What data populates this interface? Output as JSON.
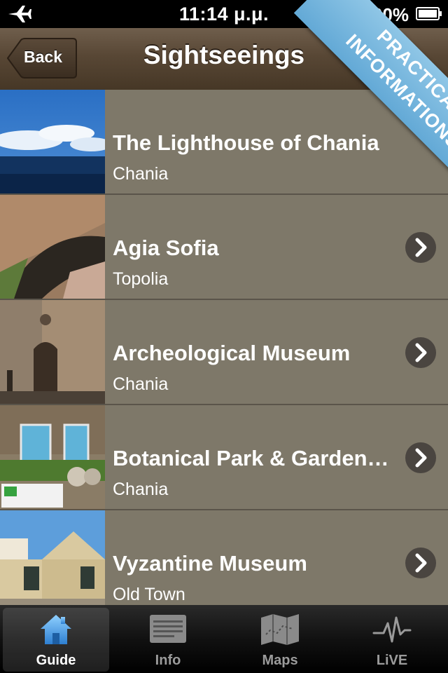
{
  "status_bar": {
    "time": "11:14 μ.μ.",
    "battery": "100%",
    "icons": [
      "airplane-icon",
      "battery-icon"
    ]
  },
  "nav": {
    "back_label": "Back",
    "title": "Sightseeings"
  },
  "ribbon": {
    "line1": "PRACTICAL",
    "line2": "INFORMATIONS",
    "color": "#6fb3de"
  },
  "list": {
    "items": [
      {
        "title": "The Lighthouse of Chania",
        "subtitle": "Chania"
      },
      {
        "title": "Agia Sofia",
        "subtitle": "Topolia"
      },
      {
        "title": "Archeological Museum",
        "subtitle": "Chania"
      },
      {
        "title": "Botanical Park & Gardens of Crete",
        "subtitle": "Chania"
      },
      {
        "title": "Vyzantine Museum",
        "subtitle": "Old Town"
      }
    ]
  },
  "tabs": [
    {
      "label": "Guide",
      "icon": "house-icon",
      "selected": true
    },
    {
      "label": "Info",
      "icon": "info-sheet-icon",
      "selected": false
    },
    {
      "label": "Maps",
      "icon": "map-icon",
      "selected": false
    },
    {
      "label": "LiVE",
      "icon": "pulse-icon",
      "selected": false
    }
  ]
}
